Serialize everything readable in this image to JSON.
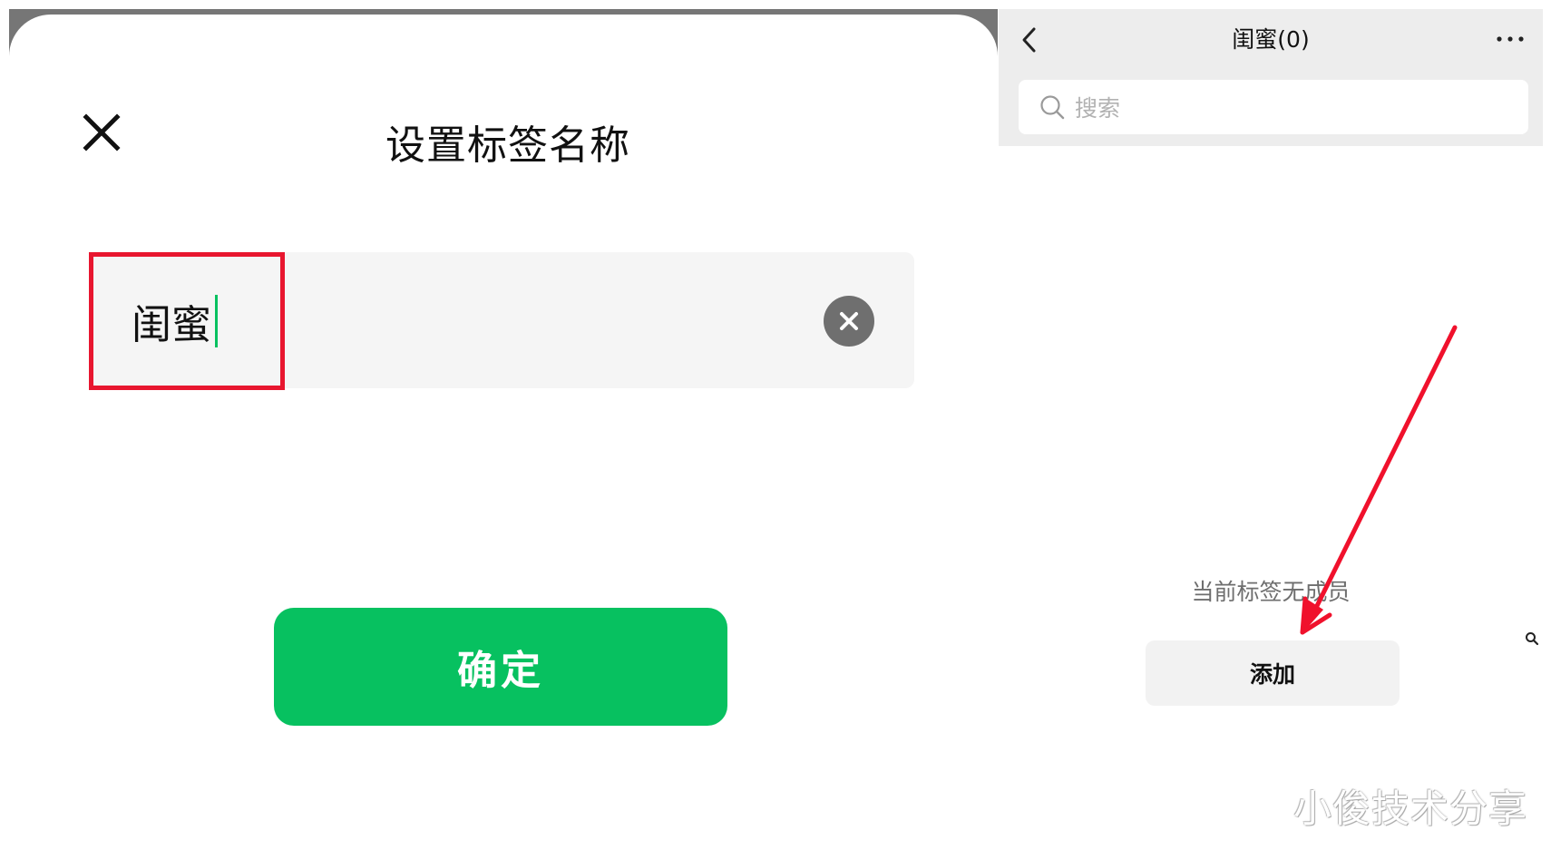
{
  "dialog": {
    "title": "设置标签名称",
    "tag_name_value": "闺蜜",
    "confirm_label": "确定",
    "colors": {
      "primary": "#07c160",
      "highlight_box": "#e8162f",
      "field_bg": "#f5f5f5"
    },
    "icons": {
      "close": "close-icon",
      "clear": "clear-icon"
    }
  },
  "tag_page": {
    "title": "闺蜜(0)",
    "search_placeholder": "搜索",
    "empty_message": "当前标签无成员",
    "add_label": "添加",
    "icons": {
      "back": "back-arrow-icon",
      "more": "more-dots-icon",
      "search": "search-icon"
    }
  },
  "annotation": {
    "arrow_color": "#f0112c"
  },
  "watermark": "小俊技术分享"
}
